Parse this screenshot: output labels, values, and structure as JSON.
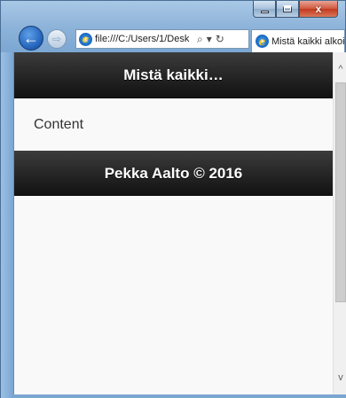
{
  "window": {
    "caption_buttons": {
      "minimize_icon": "minimize-icon",
      "maximize_icon": "maximize-icon",
      "close_glyph": "x"
    }
  },
  "nav": {
    "back_glyph": "←",
    "forward_glyph": "⇨",
    "address": "file:///C:/Users/1/Desk",
    "search_glyph": "⌕",
    "dropdown_glyph": "▾",
    "refresh_glyph": "↻",
    "tab_title": "Mistä kaikki alkoi"
  },
  "page": {
    "header_title": "Mistä kaikki…",
    "content_text": "Content",
    "footer_text": "Pekka Aalto © 2016"
  },
  "scrollbar": {
    "up_glyph": "^",
    "down_glyph": "v"
  },
  "colors": {
    "bar_dark": "#111111",
    "bar_light": "#3c3c3c",
    "page_bg": "#f9f9f9",
    "frame_blue": "#8db3d9",
    "close_red": "#c23a1f"
  }
}
